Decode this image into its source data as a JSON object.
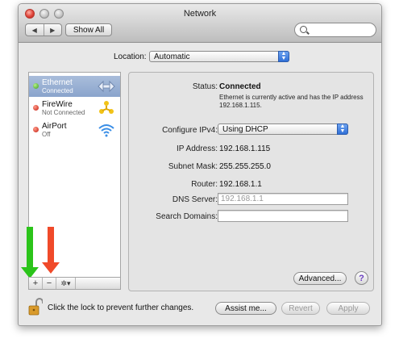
{
  "window": {
    "title": "Network"
  },
  "toolbar": {
    "back_label": "◀",
    "forward_label": "▶",
    "show_all_label": "Show All",
    "search_placeholder": ""
  },
  "location": {
    "label": "Location:",
    "value": "Automatic"
  },
  "services": [
    {
      "name": "Ethernet",
      "status": "Connected",
      "state": "green",
      "icon": "ethernet-arrows-icon",
      "selected": true
    },
    {
      "name": "FireWire",
      "status": "Not Connected",
      "state": "red",
      "icon": "firewire-icon",
      "selected": false
    },
    {
      "name": "AirPort",
      "status": "Off",
      "state": "red",
      "icon": "wifi-icon",
      "selected": false
    }
  ],
  "sidebar_controls": {
    "add_label": "+",
    "remove_label": "−",
    "action_label": "✲▾"
  },
  "details": {
    "status_label": "Status:",
    "status_value": "Connected",
    "status_description": "Ethernet is currently active and has the IP address 192.168.1.115.",
    "configure_label": "Configure IPv4:",
    "configure_value": "Using DHCP",
    "ip_label": "IP Address:",
    "ip_value": "192.168.1.115",
    "subnet_label": "Subnet Mask:",
    "subnet_value": "255.255.255.0",
    "router_label": "Router:",
    "router_value": "192.168.1.1",
    "dns_label": "DNS Server:",
    "dns_value": "192.168.1.1",
    "search_domains_label": "Search Domains:",
    "search_domains_value": "",
    "advanced_label": "Advanced...",
    "help_label": "?"
  },
  "footer": {
    "lock_text": "Click the lock to prevent further changes.",
    "assist_label": "Assist me...",
    "revert_label": "Revert",
    "apply_label": "Apply"
  },
  "colors": {
    "annotation_add": "#2bc41a",
    "annotation_remove": "#f04a2a",
    "selection": "#8aa4cc"
  }
}
